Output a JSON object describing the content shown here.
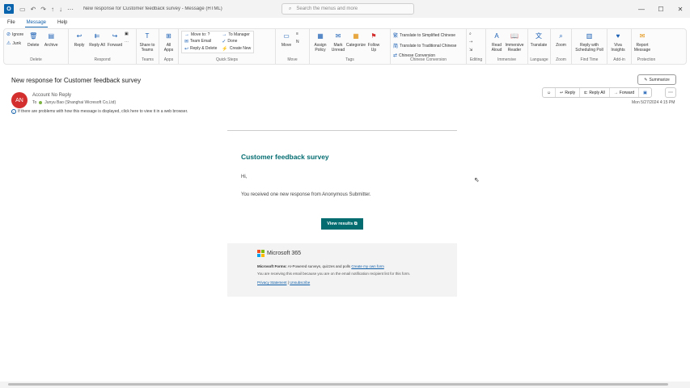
{
  "window": {
    "title": "New response for Customer feedback survey - Message (HTML)",
    "search_placeholder": "Search the menus and more",
    "controls": [
      "—",
      "☐",
      "✕"
    ]
  },
  "tabs": [
    "File",
    "Message",
    "Help"
  ],
  "ribbon": {
    "delete": {
      "ignore": "Ignore",
      "junk": "Junk",
      "delete": "Delete",
      "archive": "Archive",
      "label": "Delete"
    },
    "respond": {
      "reply": "Reply",
      "reply_all": "Reply All",
      "forward": "Forward",
      "label": "Respond"
    },
    "teams": {
      "share": "Share to Teams",
      "label": "Teams"
    },
    "apps": {
      "all_apps": "All Apps",
      "label": "Apps"
    },
    "quicksteps": {
      "items": [
        "Move to: ?",
        "To Manager",
        "Team Email",
        "Done",
        "Reply & Delete",
        "Create New"
      ],
      "label": "Quick Steps"
    },
    "move": {
      "move": "Move",
      "label": "Move"
    },
    "tags": {
      "assign": "Assign Policy",
      "unread": "Mark Unread",
      "categorize": "Categorize",
      "follow": "Follow Up",
      "label": "Tags"
    },
    "chinese": {
      "simplified": "Translate to Simplified Chinese",
      "traditional": "Translate to Traditional Chinese",
      "conversion": "Chinese Conversion",
      "label": "Chinese Conversion"
    },
    "editing": {
      "label": "Editing"
    },
    "immersive": {
      "read": "Read Aloud",
      "reader": "Immersive Reader",
      "label": "Immersive"
    },
    "language": {
      "translate": "Translate",
      "label": "Language"
    },
    "zoom": {
      "zoom": "Zoom",
      "label": "Zoom"
    },
    "findtime": {
      "reply": "Reply with Scheduling Poll",
      "label": "Find Time"
    },
    "addin": {
      "viva": "Viva Insights",
      "label": "Add-in"
    },
    "protection": {
      "report": "Report Message",
      "label": "Protection"
    }
  },
  "message": {
    "subject": "New response for Customer feedback survey",
    "summarize": "Summarize",
    "avatar": "AN",
    "sender": "Account No Reply",
    "to_label": "To",
    "recipient": "Junyu Bao (Shanghai Wicresoft Co,Ltd)",
    "info": "If there are problems with how this message is displayed, click here to view it in a web browser.",
    "actions": {
      "reply": "Reply",
      "reply_all": "Reply All",
      "forward": "Forward"
    },
    "date": "Mon 5/27/2024 4:15 PM"
  },
  "email": {
    "heading": "Customer feedback survey",
    "greeting": "Hi,",
    "body": "You received one new response from Anonymous Submitter.",
    "button": "View results",
    "brand": "Microsoft 365",
    "footer_bold": "Microsoft Forms:",
    "footer_text": " AI-Powered surveys, quizzes and polls ",
    "footer_link": "Create my own form",
    "notice": "You are receiving this email because you are on the email notification recipient list for this form.",
    "privacy": "Privacy Statement",
    "sep": " | ",
    "unsubscribe": "Unsubscribe"
  }
}
